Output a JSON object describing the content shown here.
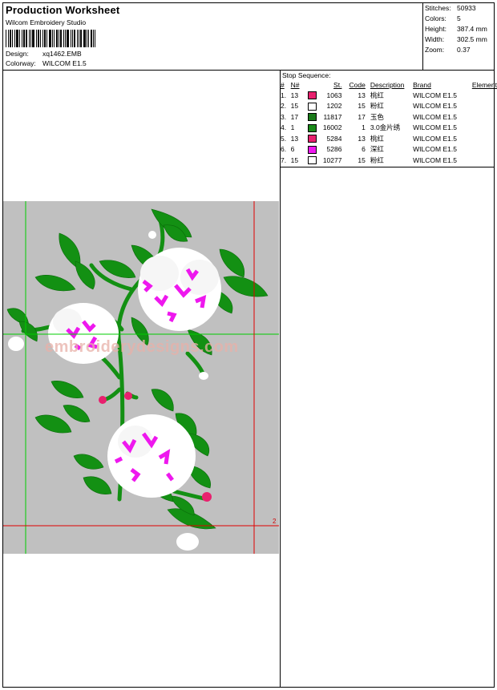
{
  "header": {
    "title": "Production Worksheet",
    "software": "Wilcom Embroidery Studio",
    "design_label": "Design:",
    "design_value": "xq1462.EMB",
    "colorway_label": "Colorway:",
    "colorway_value": "WILCOM E1.5"
  },
  "stats": {
    "stitches_label": "Stitches:",
    "stitches_value": "50933",
    "colors_label": "Colors:",
    "colors_value": "5",
    "height_label": "Height:",
    "height_value": "387.4 mm",
    "width_label": "Width:",
    "width_value": "302.5 mm",
    "zoom_label": "Zoom:",
    "zoom_value": "0.37"
  },
  "stop_sequence": {
    "title": "Stop Sequence:",
    "columns": [
      "#",
      "N#",
      "St.",
      "Code",
      "Description",
      "Brand",
      "Element"
    ],
    "rows": [
      {
        "num": "1.",
        "n": "13",
        "color": "#e8206e",
        "st": "1063",
        "code": "13",
        "desc": "桃红",
        "brand": "WILCOM E1.5",
        "element": ""
      },
      {
        "num": "2.",
        "n": "15",
        "color": "#ffffff",
        "st": "1202",
        "code": "15",
        "desc": "粉红",
        "brand": "WILCOM E1.5",
        "element": ""
      },
      {
        "num": "3.",
        "n": "17",
        "color": "#1a7a1a",
        "st": "11817",
        "code": "17",
        "desc": "玉色",
        "brand": "WILCOM E1.5",
        "element": ""
      },
      {
        "num": "4.",
        "n": "1",
        "color": "#1a8a1a",
        "st": "16002",
        "code": "1",
        "desc": "3.0金片绣",
        "brand": "WILCOM E1.5",
        "element": ""
      },
      {
        "num": "5.",
        "n": "13",
        "color": "#e8206e",
        "st": "5284",
        "code": "13",
        "desc": "桃红",
        "brand": "WILCOM E1.5",
        "element": ""
      },
      {
        "num": "6.",
        "n": "6",
        "color": "#ee18ee",
        "st": "5286",
        "code": "6",
        "desc": "深红",
        "brand": "WILCOM E1.5",
        "element": ""
      },
      {
        "num": "7.",
        "n": "15",
        "color": "#ffffff",
        "st": "10277",
        "code": "15",
        "desc": "粉红",
        "brand": "WILCOM E1.5",
        "element": ""
      }
    ]
  },
  "preview": {
    "watermark": "embroiderydesigns.com",
    "guide_label": "2"
  }
}
